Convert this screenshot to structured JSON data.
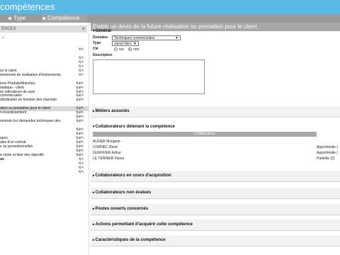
{
  "app": {
    "title": "compétences"
  },
  "tabs": [
    {
      "label": "Type"
    },
    {
      "label": "Compétence"
    }
  ],
  "content_title": "Etablir un devis de la future réalisation ou prestation pour le client",
  "left_panel": {
    "header": "ENCES",
    "close": "×",
    "items": [
      {
        "text": "",
        "icons": "⇅✎",
        "selected": false,
        "bold": false
      },
      {
        "text": "",
        "icons": "",
        "selected": false,
        "bold": false
      },
      {
        "text": "",
        "icons": "⇅✎",
        "selected": false,
        "bold": false
      },
      {
        "text": "",
        "icons": "⇅✎",
        "selected": false,
        "bold": false
      },
      {
        "text": "",
        "icons": "⇅✎",
        "selected": false,
        "bold": false
      },
      {
        "text": "ez le client",
        "icons": "⇅✎",
        "selected": false,
        "bold": false
      },
      {
        "text": "évisionnel de réalisation d'évènements",
        "icons": "⇅✎",
        "selected": false,
        "bold": false
      },
      {
        "text": "",
        "icons": "",
        "selected": false,
        "bold": false
      },
      {
        "text": "ions Produits/Marchés",
        "icons": "⇅⊕✎",
        "selected": false,
        "bold": false
      },
      {
        "text": "matique - client",
        "icons": "⇅⊕✎",
        "selected": false,
        "bold": false
      },
      {
        "text": "es indicateurs de suivi",
        "icons": "⇅⊕✎",
        "selected": false,
        "bold": false
      },
      {
        "text": "commerciales",
        "icons": "⇅⊕✎",
        "selected": false,
        "bold": false
      },
      {
        "text": "distribution en fonction des marchés",
        "icons": "⇅⊕✎",
        "selected": false,
        "bold": false
      },
      {
        "text": "",
        "icons": "",
        "selected": false,
        "bold": false
      },
      {
        "text": "ation ou prestation pour le client",
        "icons": "⇅⊕✎",
        "selected": true,
        "bold": false
      },
      {
        "text": "n investissement",
        "icons": "⇅⊕✎",
        "selected": false,
        "bold": false
      },
      {
        "text": "",
        "icons": "⇅⊕✎",
        "selected": false,
        "bold": false
      },
      {
        "text": "ncernés les demandes techniques des",
        "icons": "⇅⊕✎",
        "selected": false,
        "bold": false
      },
      {
        "text": "",
        "icons": "",
        "selected": false,
        "bold": false
      },
      {
        "text": "",
        "icons": "⇅⊕✎",
        "selected": false,
        "bold": false
      },
      {
        "text": "",
        "icons": "⇅⊕✎",
        "selected": false,
        "bold": false
      },
      {
        "text": "ques",
        "icons": "⇅⊕✎",
        "selected": false,
        "bold": false
      },
      {
        "text": "ales d'un contrat",
        "icons": "⇅⊕✎",
        "selected": false,
        "bold": false
      },
      {
        "text": "s ou promotionnelles",
        "icons": "⇅⊕✎",
        "selected": false,
        "bold": false
      },
      {
        "text": "",
        "icons": "⇅⊕✎",
        "selected": false,
        "bold": false
      },
      {
        "text": "e vente et fixer des objectifs",
        "icons": "⇅⊕✎",
        "selected": false,
        "bold": false
      },
      {
        "text": "ux",
        "icons": "⇅✎",
        "selected": false,
        "bold": true
      },
      {
        "text": "",
        "icons": "⇅✎",
        "selected": false,
        "bold": false
      },
      {
        "text": "",
        "icons": "⇅✎",
        "selected": false,
        "bold": false
      },
      {
        "text": "",
        "icons": "⇅✎",
        "selected": false,
        "bold": false
      }
    ]
  },
  "general": {
    "title": "Général",
    "domaine_label": "Domaine",
    "domaine_value": "Techniques commerciales",
    "type_label": "Type",
    "type_value": "savoir-faire",
    "cle_label": "Clé",
    "oui": "oui",
    "non": "non",
    "description_label": "Description"
  },
  "sections": {
    "metiers": "Métiers associés",
    "collab_detenant": "Collaborateurs détenant la compétence",
    "collab_cours": "Collaborateurs en cours d'acquisition",
    "collab_non_eval": "Collaborateurs non évalués",
    "postes": "Postes ouverts concernés",
    "actions": "Actions permettant d'acquérir cette compétence",
    "caracteristiques": "Caractéristiques de la compétence"
  },
  "collab_table": {
    "header": "Collaborateur",
    "rows": [
      {
        "name": "AUGER Morgane",
        "level": ""
      },
      {
        "name": "CORNEC René",
        "level": "Approfondie ("
      },
      {
        "name": "GUEFFIER Arthur",
        "level": "Approfondie ("
      },
      {
        "name": "LE TENNIER Flavia",
        "level": "Partielle (2)"
      }
    ]
  },
  "colors": {
    "titlebar": "#58b8e6",
    "tabbar": "#9a9a9a",
    "header_gray": "#a8a8a8"
  }
}
